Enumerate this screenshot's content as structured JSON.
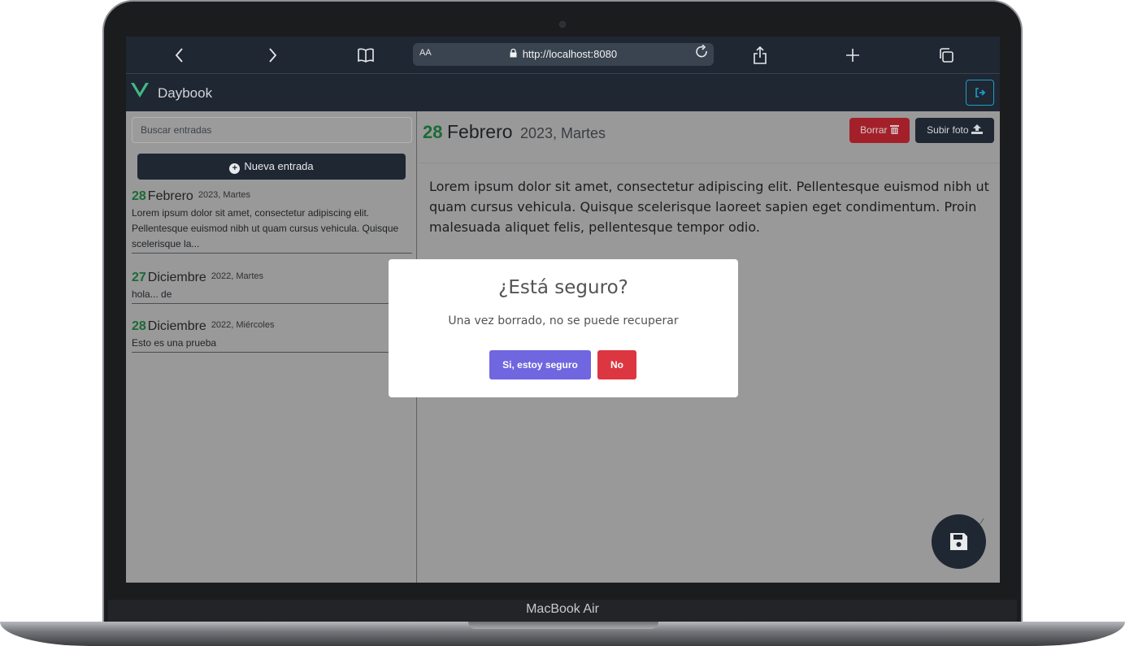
{
  "device": {
    "label": "MacBook Air"
  },
  "browser": {
    "text_size_label": "AA",
    "url": "http://localhost:8080",
    "icons": [
      "back-icon",
      "forward-icon",
      "bookmarks-icon",
      "lock-icon",
      "reload-icon",
      "share-icon",
      "new-tab-icon",
      "tabs-icon"
    ]
  },
  "app": {
    "brand": "Daybook",
    "logout_icon": "sign-out-icon"
  },
  "sidebar": {
    "search_placeholder": "Buscar entradas",
    "new_entry_label": "Nueva entrada",
    "entries": [
      {
        "day": "28",
        "month": "Febrero",
        "year_weekday": "2023, Martes",
        "text": "Lorem ipsum dolor sit amet, consectetur adipiscing elit. Pellentesque euismod nibh ut quam cursus vehicula. Quisque scelerisque la..."
      },
      {
        "day": "27",
        "month": "Diciembre",
        "year_weekday": "2022, Martes",
        "text": "hola... de"
      },
      {
        "day": "28",
        "month": "Diciembre",
        "year_weekday": "2022, Miércoles",
        "text": "Esto es una prueba"
      }
    ]
  },
  "entry_view": {
    "day": "28",
    "month": "Febrero",
    "year_weekday": "2023, Martes",
    "delete_label": "Borrar",
    "upload_label": "Subir foto",
    "text": "Lorem ipsum dolor sit amet, consectetur adipiscing elit. Pellentesque euismod nibh ut quam cursus vehicula. Quisque scelerisque laoreet sapien eget condimentum. Proin malesuada aliquet felis, pellentesque tempor odio.",
    "save_icon": "floppy-disk-icon"
  },
  "modal": {
    "title": "¿Está seguro?",
    "text": "Una vez borrado, no se puede recuperar",
    "confirm_label": "Si, estoy seguro",
    "cancel_label": "No"
  },
  "colors": {
    "navbar": "#1f2733",
    "accent_green": "#1b6b35",
    "confirm_button": "#7066e0",
    "cancel_button": "#dc3741",
    "delete_button": "#a3202a",
    "logout_outline": "#1a9fc9"
  }
}
